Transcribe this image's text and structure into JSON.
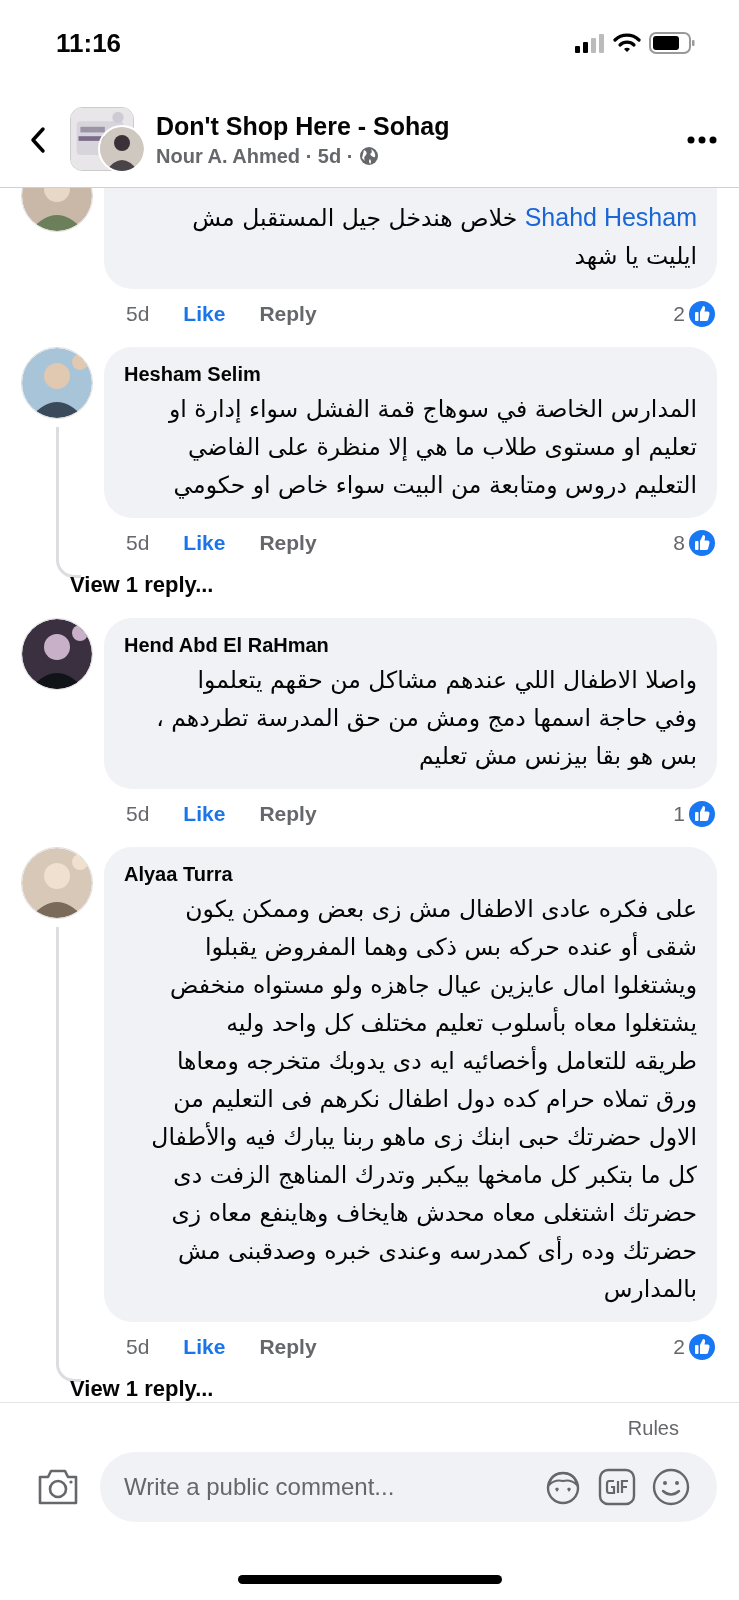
{
  "status_bar": {
    "time": "11:16"
  },
  "header": {
    "title": "Don't Shop Here - Sohag",
    "subtitle": "Nour A. Ahmed · 5d ·"
  },
  "comments": [
    {
      "mention": "Shahd Hesham",
      "lines": [
        "خلاص هندخل جيل المستقبل مش",
        "ايليت يا شهد"
      ],
      "time": "5d",
      "like": "Like",
      "liked": true,
      "reply": "Reply",
      "reactions": "2"
    },
    {
      "author": "Hesham Selim",
      "lines": [
        "المدارس الخاصة في سوهاج قمة الفشل سواء إدارة او",
        "تعليم او مستوى طلاب ما هي إلا منظرة على الفاضي",
        "التعليم دروس ومتابعة من البيت سواء خاص او حكومي"
      ],
      "time": "5d",
      "like": "Like",
      "liked": true,
      "reply": "Reply",
      "reactions": "8",
      "replies": "View 1 reply..."
    },
    {
      "author": "Hend Abd El RaHman",
      "lines": [
        "واصلا الاطفال اللي عندهم مشاكل من حقهم يتعلموا",
        "وفي حاجة اسمها دمج ومش من حق المدرسة تطردهم ،",
        "بس هو بقا بيزنس مش تعليم"
      ],
      "time": "5d",
      "like": "Like",
      "liked": true,
      "reply": "Reply",
      "reactions": "1"
    },
    {
      "author": "Alyaa Turra",
      "lines": [
        "على فكره عادى الاطفال مش زى بعض وممكن يكون",
        "شقى أو عنده حركه بس ذكى وهما المفروض يقبلوا",
        "ويشتغلوا امال عايزين عيال جاهزه ولو مستواه منخفض",
        "يشتغلوا معاه بأسلوب تعليم مختلف كل واحد وليه",
        "طريقه للتعامل وأخصائيه ايه دى يدوبك متخرجه ومعاها",
        "ورق تملاه حرام كده دول اطفال نكرهم فى التعليم من",
        "الاول حضرتك حبى ابنك زى ماهو ربنا يبارك فيه والأطفال",
        "كل ما بتكبر كل مامخها بيكبر وتدرك المناهج الزفت دى",
        "حضرتك اشتغلى معاه محدش هايخاف وهاينفع معاه زى",
        "حضرتك وده رأى كمدرسه وعندى خبره وصدقبنى مش",
        "بالمدارس"
      ],
      "time": "5d",
      "like": "Like",
      "liked": true,
      "reply": "Reply",
      "reactions": "2",
      "replies": "View 1 reply..."
    }
  ],
  "composer": {
    "rules": "Rules",
    "placeholder": "Write a public comment..."
  }
}
